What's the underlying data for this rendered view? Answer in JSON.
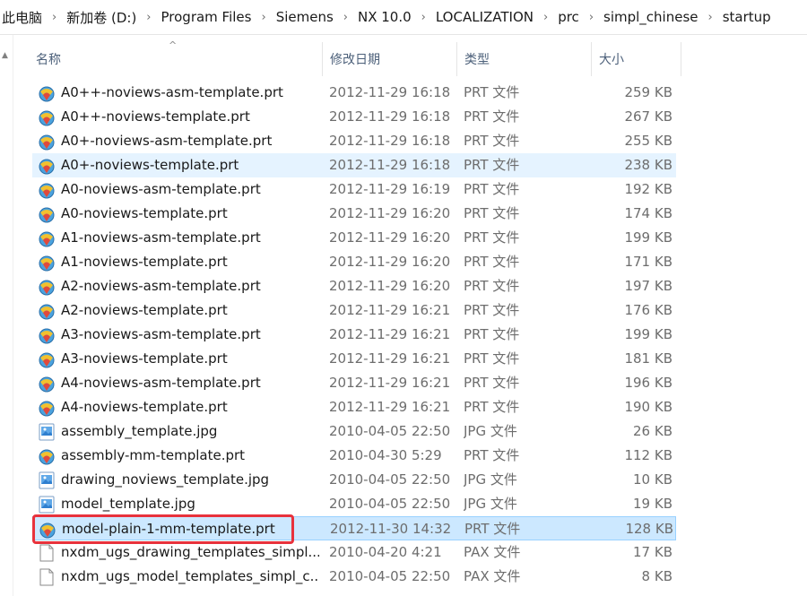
{
  "breadcrumb": [
    "此电脑",
    "新加卷 (D:)",
    "Program Files",
    "Siemens",
    "NX 10.0",
    "LOCALIZATION",
    "prc",
    "simpl_chinese",
    "startup"
  ],
  "columns": {
    "name": "名称",
    "date": "修改日期",
    "type": "类型",
    "size": "大小"
  },
  "files": [
    {
      "icon": "nx-prt-icon",
      "name": "A0++-noviews-asm-template.prt",
      "date": "2012-11-29 16:18",
      "type": "PRT 文件",
      "size": "259 KB",
      "state": "normal"
    },
    {
      "icon": "nx-prt-icon",
      "name": "A0++-noviews-template.prt",
      "date": "2012-11-29 16:18",
      "type": "PRT 文件",
      "size": "267 KB",
      "state": "normal"
    },
    {
      "icon": "nx-prt-icon",
      "name": "A0+-noviews-asm-template.prt",
      "date": "2012-11-29 16:18",
      "type": "PRT 文件",
      "size": "255 KB",
      "state": "normal"
    },
    {
      "icon": "nx-prt-icon",
      "name": "A0+-noviews-template.prt",
      "date": "2012-11-29 16:18",
      "type": "PRT 文件",
      "size": "238 KB",
      "state": "hover"
    },
    {
      "icon": "nx-prt-icon",
      "name": "A0-noviews-asm-template.prt",
      "date": "2012-11-29 16:19",
      "type": "PRT 文件",
      "size": "192 KB",
      "state": "normal"
    },
    {
      "icon": "nx-prt-icon",
      "name": "A0-noviews-template.prt",
      "date": "2012-11-29 16:20",
      "type": "PRT 文件",
      "size": "174 KB",
      "state": "normal"
    },
    {
      "icon": "nx-prt-icon",
      "name": "A1-noviews-asm-template.prt",
      "date": "2012-11-29 16:20",
      "type": "PRT 文件",
      "size": "199 KB",
      "state": "normal"
    },
    {
      "icon": "nx-prt-icon",
      "name": "A1-noviews-template.prt",
      "date": "2012-11-29 16:20",
      "type": "PRT 文件",
      "size": "171 KB",
      "state": "normal"
    },
    {
      "icon": "nx-prt-icon",
      "name": "A2-noviews-asm-template.prt",
      "date": "2012-11-29 16:20",
      "type": "PRT 文件",
      "size": "197 KB",
      "state": "normal"
    },
    {
      "icon": "nx-prt-icon",
      "name": "A2-noviews-template.prt",
      "date": "2012-11-29 16:21",
      "type": "PRT 文件",
      "size": "176 KB",
      "state": "normal"
    },
    {
      "icon": "nx-prt-icon",
      "name": "A3-noviews-asm-template.prt",
      "date": "2012-11-29 16:21",
      "type": "PRT 文件",
      "size": "199 KB",
      "state": "normal"
    },
    {
      "icon": "nx-prt-icon",
      "name": "A3-noviews-template.prt",
      "date": "2012-11-29 16:21",
      "type": "PRT 文件",
      "size": "181 KB",
      "state": "normal"
    },
    {
      "icon": "nx-prt-icon",
      "name": "A4-noviews-asm-template.prt",
      "date": "2012-11-29 16:21",
      "type": "PRT 文件",
      "size": "196 KB",
      "state": "normal"
    },
    {
      "icon": "nx-prt-icon",
      "name": "A4-noviews-template.prt",
      "date": "2012-11-29 16:21",
      "type": "PRT 文件",
      "size": "190 KB",
      "state": "normal"
    },
    {
      "icon": "image-file-icon",
      "name": "assembly_template.jpg",
      "date": "2010-04-05 22:50",
      "type": "JPG 文件",
      "size": "26 KB",
      "state": "normal"
    },
    {
      "icon": "nx-prt-icon",
      "name": "assembly-mm-template.prt",
      "date": "2010-04-30 5:29",
      "type": "PRT 文件",
      "size": "112 KB",
      "state": "normal"
    },
    {
      "icon": "image-file-icon",
      "name": "drawing_noviews_template.jpg",
      "date": "2010-04-05 22:50",
      "type": "JPG 文件",
      "size": "10 KB",
      "state": "normal"
    },
    {
      "icon": "image-file-icon",
      "name": "model_template.jpg",
      "date": "2010-04-05 22:50",
      "type": "JPG 文件",
      "size": "19 KB",
      "state": "normal"
    },
    {
      "icon": "nx-prt-icon",
      "name": "model-plain-1-mm-template.prt",
      "date": "2012-11-30 14:32",
      "type": "PRT 文件",
      "size": "128 KB",
      "state": "selected"
    },
    {
      "icon": "blank-file-icon",
      "name": "nxdm_ugs_drawing_templates_simpl...",
      "date": "2010-04-20 4:21",
      "type": "PAX 文件",
      "size": "17 KB",
      "state": "normal"
    },
    {
      "icon": "blank-file-icon",
      "name": "nxdm_ugs_model_templates_simpl_c...",
      "date": "2010-04-05 22:50",
      "type": "PAX 文件",
      "size": "8 KB",
      "state": "normal"
    }
  ],
  "colors": {
    "hover": "#e5f3ff",
    "selected": "#cce8ff",
    "highlight_box": "#e8323c",
    "header_text": "#4c607a"
  }
}
